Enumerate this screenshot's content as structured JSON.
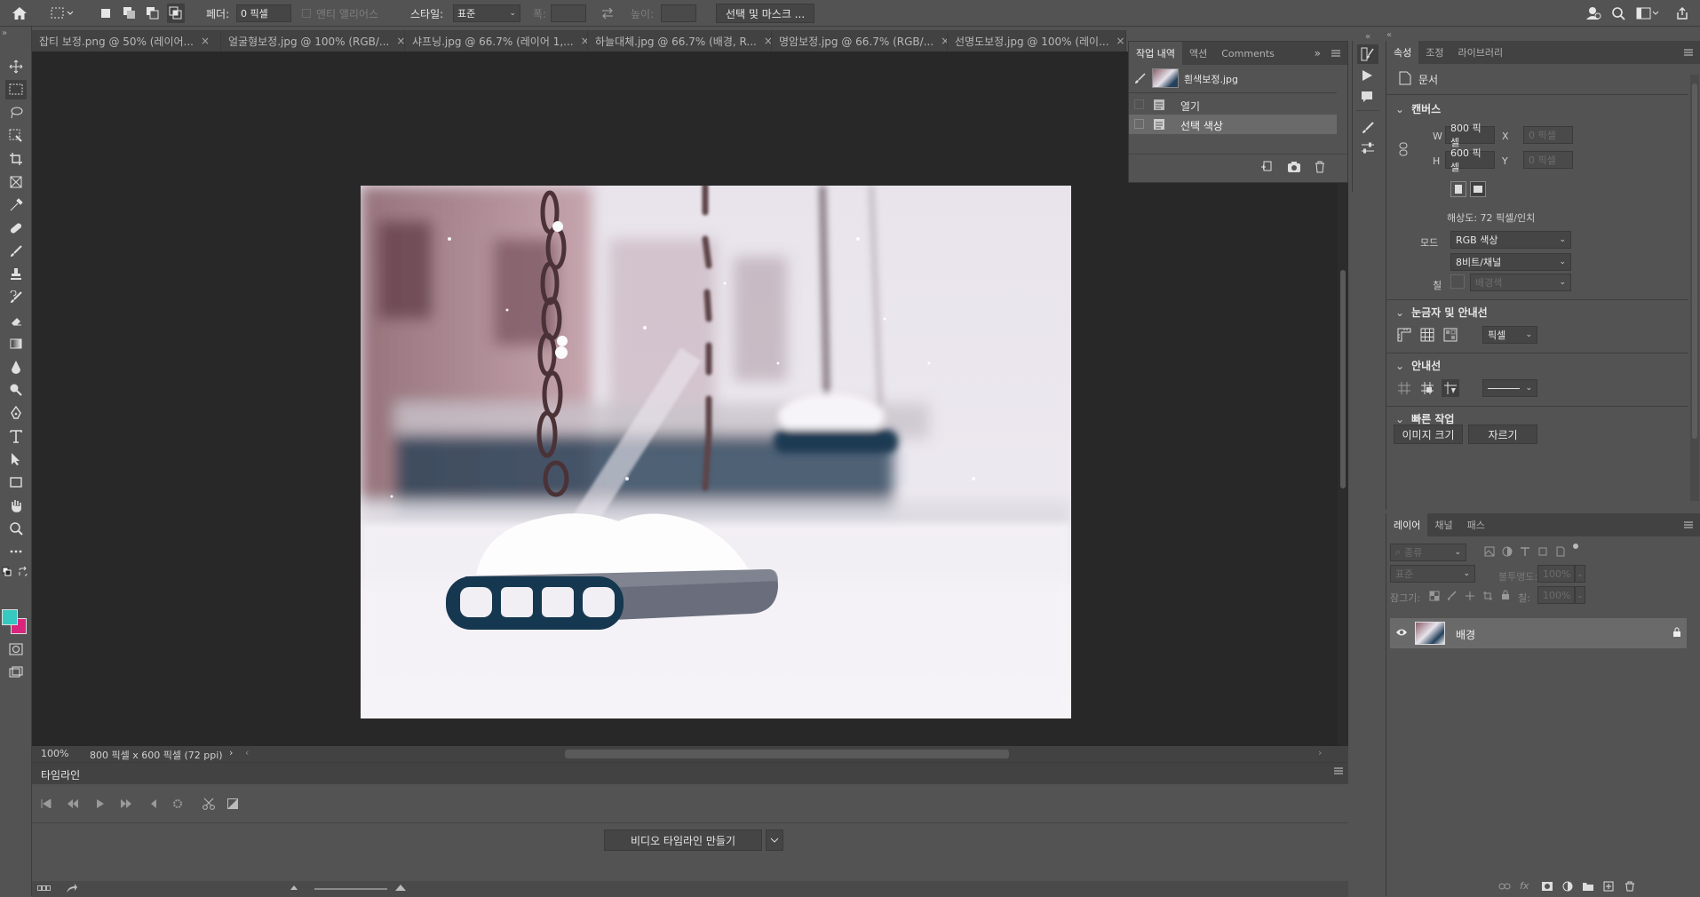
{
  "options_bar": {
    "feather_label": "페더:",
    "feather_value": "0 픽셀",
    "antialias_label": "앤티 앨리어스",
    "style_label": "스타일:",
    "style_value": "표준",
    "width_label": "폭:",
    "height_label": "높이:",
    "select_mask_button": "선택 및 마스크 ..."
  },
  "tabs": [
    {
      "label": "잡티 보정.png @ 50% (레이어..."
    },
    {
      "label": "얼굴형보정.jpg @ 100% (RGB/..."
    },
    {
      "label": "샤프닝.jpg @ 66.7% (레이어 1,..."
    },
    {
      "label": "하늘대체.jpg @ 66.7% (배경, R..."
    },
    {
      "label": "명암보정.jpg @ 66.7% (RGB/..."
    },
    {
      "label": "선명도보정.jpg @ 100% (레이..."
    }
  ],
  "status": {
    "zoom": "100%",
    "doc_info": "800 픽셀 x 600 픽셀 (72 ppi)"
  },
  "history_panel": {
    "tabs": [
      "작업 내역",
      "액션",
      "Comments"
    ],
    "snapshot_label": "흰색보정.jpg",
    "items": [
      {
        "label": "열기"
      },
      {
        "label": "선택 색상"
      }
    ]
  },
  "properties": {
    "tabs": [
      "속성",
      "조정",
      "라이브러리"
    ],
    "doc_label": "문서",
    "canvas_section": "캔버스",
    "w_label": "W",
    "w_value": "800 픽셀",
    "h_label": "H",
    "h_value": "600 픽셀",
    "x_label": "X",
    "x_placeholder": "0 픽셀",
    "y_label": "Y",
    "y_placeholder": "0 픽셀",
    "resolution": "해상도: 72 픽셀/인치",
    "mode_label": "모드",
    "mode_value": "RGB 색상",
    "bits_value": "8비트/채널",
    "fill_label": "칠",
    "fill_value": "배경색",
    "rulers_section": "눈금자 및 안내선",
    "rulers_unit": "픽셀",
    "guides_section": "안내선",
    "quick_section": "빠른 작업",
    "image_size_button": "이미지 크기",
    "crop_button": "자르기"
  },
  "layers": {
    "tabs": [
      "레이어",
      "채널",
      "패스"
    ],
    "filter_label": "종류",
    "blend_mode": "표준",
    "opacity_label": "불투명도:",
    "opacity_value": "100%",
    "lock_label": "잠그기:",
    "fill_label": "칠:",
    "fill_value": "100%",
    "items": [
      {
        "name": "배경"
      }
    ]
  },
  "timeline": {
    "title": "타임라인",
    "create_button": "비디오 타임라인 만들기"
  },
  "colors": {
    "foreground": "#36c9c0",
    "background": "#d8267d",
    "ui_panel": "#535353",
    "canvas_bg": "#282828"
  }
}
